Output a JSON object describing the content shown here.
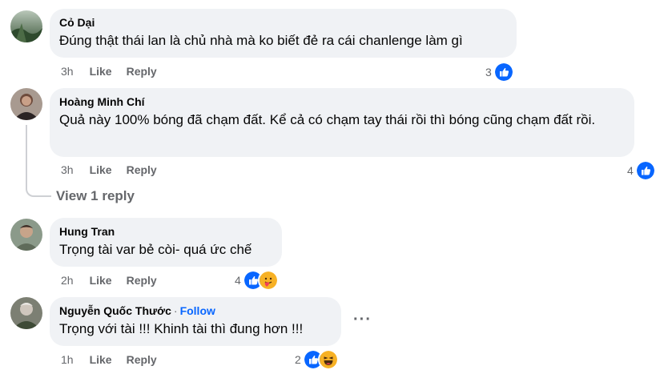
{
  "comments": [
    {
      "author": "Cỏ Dại",
      "text": "Đúng thật thái lan là chủ nhà mà ko biết đẻ ra cái chanlenge làm gì",
      "time": "3h",
      "like": "Like",
      "reply": "Reply",
      "reaction_count": "3",
      "reactions": [
        "like-icon"
      ]
    },
    {
      "author": "Hoàng Minh Chí",
      "text": "Quả này 100% bóng đã chạm đất. Kể cả có chạm tay thái rồi thì bóng cũng chạm đất rồi.",
      "time": "3h",
      "like": "Like",
      "reply": "Reply",
      "reaction_count": "4",
      "reactions": [
        "like-icon"
      ],
      "view_replies": "View 1 reply"
    },
    {
      "author": "Hung Tran",
      "text": "Trọng tài var bẻ còi- quá ức chế",
      "time": "2h",
      "like": "Like",
      "reply": "Reply",
      "reaction_count": "4",
      "reactions": [
        "like-icon",
        "care-icon"
      ]
    },
    {
      "author": "Nguyễn Quốc Thước",
      "separator": "·",
      "follow": "Follow",
      "text": "Trọng với tài !!! Khinh tài thì đung hơn !!!",
      "time": "1h",
      "like": "Like",
      "reply": "Reply",
      "reaction_count": "2",
      "reactions": [
        "like-icon",
        "haha-icon"
      ],
      "more": "···"
    }
  ],
  "colors": {
    "bubble": "#f0f2f5",
    "secondary_text": "#65676b",
    "like_blue": "#0866ff",
    "follow_blue": "#0866ff"
  }
}
